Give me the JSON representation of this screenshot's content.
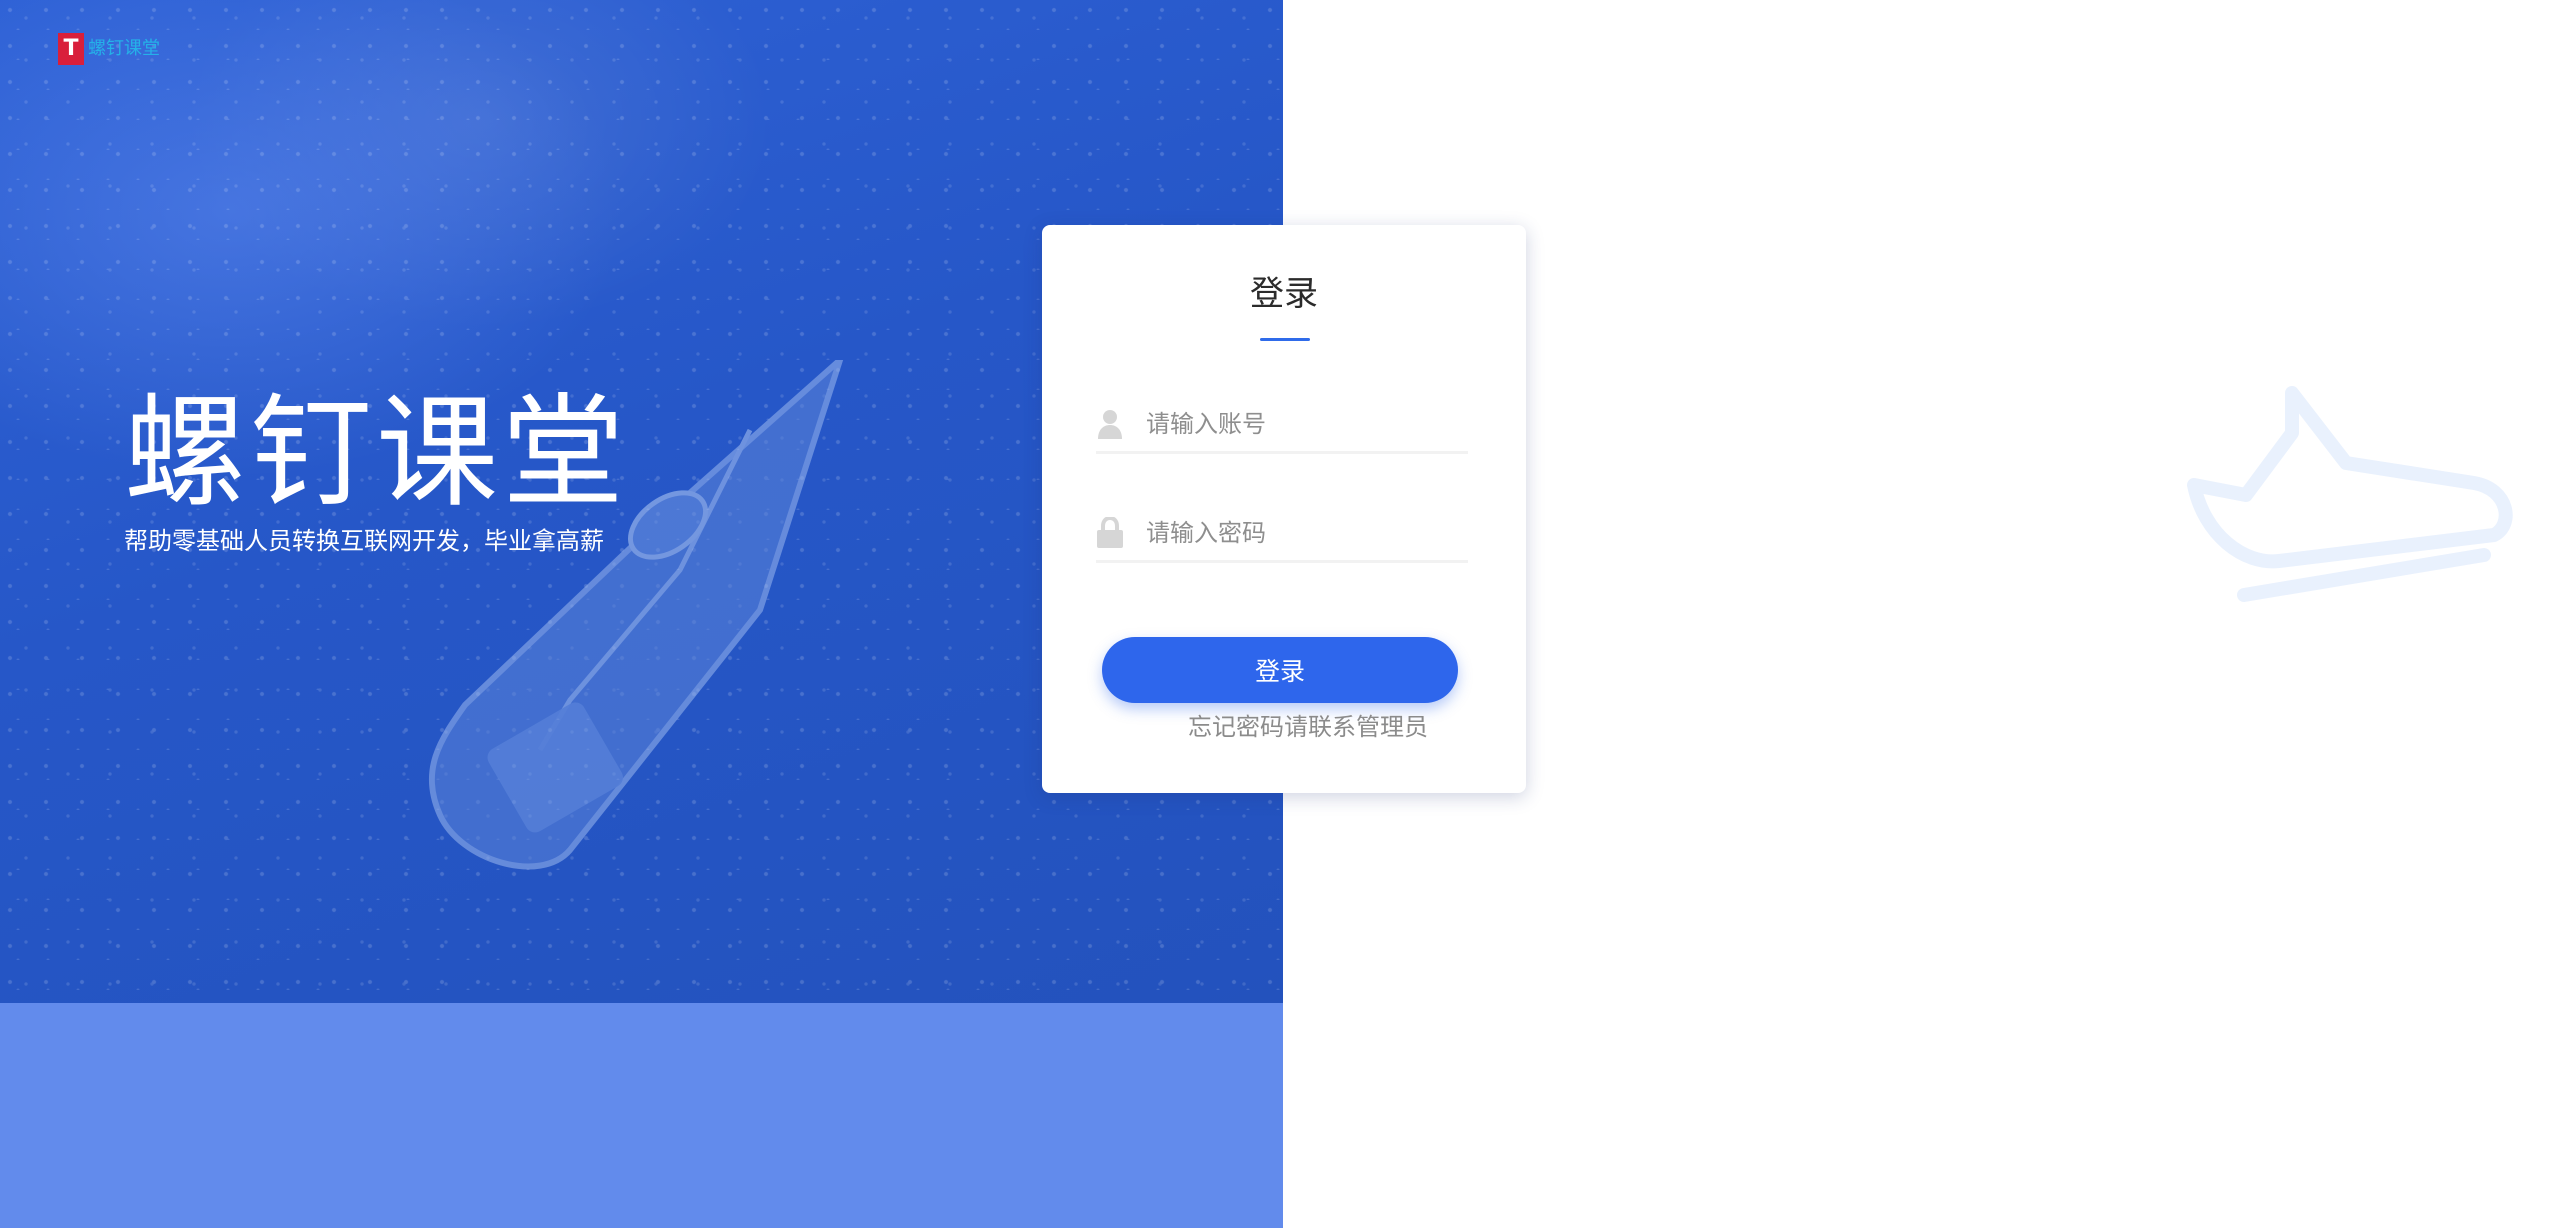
{
  "brand": {
    "logo_mark": "T",
    "logo_text": "螺钉课堂",
    "hero_title": "螺钉课堂",
    "hero_subtitle": "帮助零基础人员转换互联网开发，毕业拿高薪"
  },
  "login": {
    "title": "登录",
    "account_placeholder": "请输入账号",
    "password_placeholder": "请输入密码",
    "submit_label": "登录",
    "forgot_text": "忘记密码请联系管理员"
  },
  "icons": {
    "logo": "tmall-style-logo-icon",
    "user": "user-icon",
    "lock": "lock-icon",
    "decor": "paper-plane-icon"
  },
  "colors": {
    "primary": "#2e66ec",
    "hero_blue": "#2657c8",
    "hero_bottom": "#628bec",
    "logo_red": "#d91f3b",
    "muted_text": "#8b8b8b"
  }
}
